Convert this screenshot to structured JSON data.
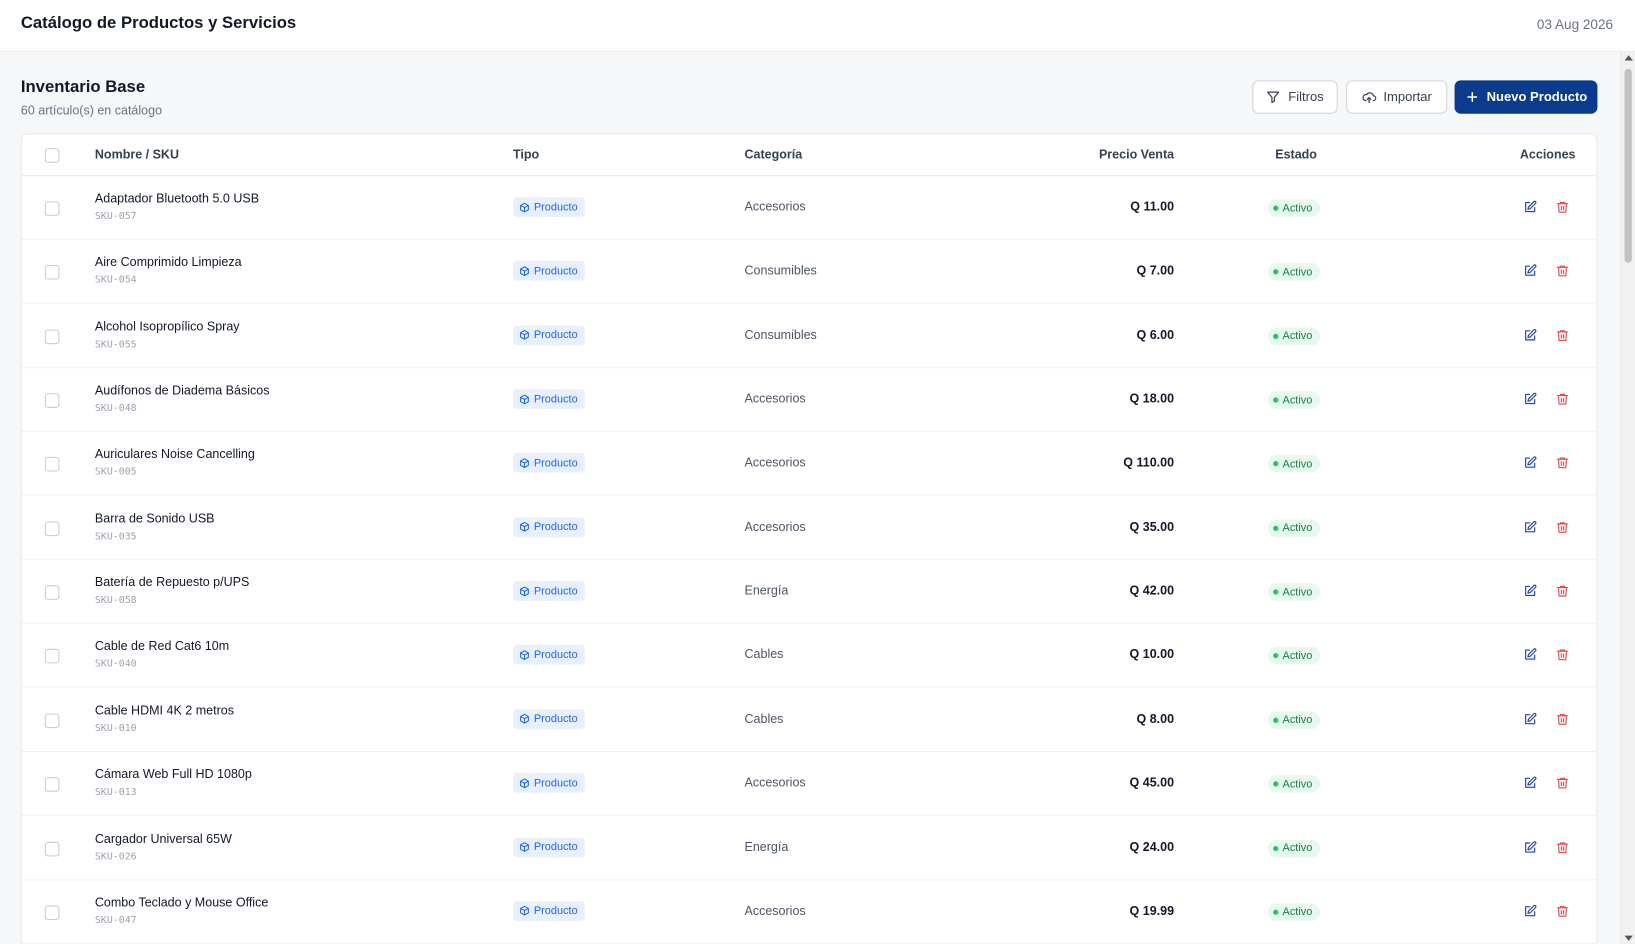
{
  "header": {
    "title": "Catálogo de Productos y Servicios",
    "date": "03 Aug 2026"
  },
  "section": {
    "title": "Inventario Base",
    "subtitle": "60 artículo(s) en catálogo"
  },
  "toolbar": {
    "filters_label": "Filtros",
    "import_label": "Importar",
    "new_label": "Nuevo Producto"
  },
  "table": {
    "columns": {
      "name": "Nombre / SKU",
      "type": "Tipo",
      "category": "Categoría",
      "price": "Precio Venta",
      "status": "Estado",
      "actions": "Acciones"
    },
    "rows": [
      {
        "name": "Adaptador Bluetooth 5.0 USB",
        "sku": "SKU-057",
        "type": "Producto",
        "category": "Accesorios",
        "price": "Q 11.00",
        "status": "Activo"
      },
      {
        "name": "Aire Comprimido Limpieza",
        "sku": "SKU-054",
        "type": "Producto",
        "category": "Consumibles",
        "price": "Q 7.00",
        "status": "Activo"
      },
      {
        "name": "Alcohol Isopropílico Spray",
        "sku": "SKU-055",
        "type": "Producto",
        "category": "Consumibles",
        "price": "Q 6.00",
        "status": "Activo"
      },
      {
        "name": "Audífonos de Diadema Básicos",
        "sku": "SKU-048",
        "type": "Producto",
        "category": "Accesorios",
        "price": "Q 18.00",
        "status": "Activo"
      },
      {
        "name": "Auriculares Noise Cancelling",
        "sku": "SKU-005",
        "type": "Producto",
        "category": "Accesorios",
        "price": "Q 110.00",
        "status": "Activo"
      },
      {
        "name": "Barra de Sonido USB",
        "sku": "SKU-035",
        "type": "Producto",
        "category": "Accesorios",
        "price": "Q 35.00",
        "status": "Activo"
      },
      {
        "name": "Batería de Repuesto p/UPS",
        "sku": "SKU-058",
        "type": "Producto",
        "category": "Energía",
        "price": "Q 42.00",
        "status": "Activo"
      },
      {
        "name": "Cable de Red Cat6 10m",
        "sku": "SKU-040",
        "type": "Producto",
        "category": "Cables",
        "price": "Q 10.00",
        "status": "Activo"
      },
      {
        "name": "Cable HDMI 4K 2 metros",
        "sku": "SKU-010",
        "type": "Producto",
        "category": "Cables",
        "price": "Q 8.00",
        "status": "Activo"
      },
      {
        "name": "Cámara Web Full HD 1080p",
        "sku": "SKU-013",
        "type": "Producto",
        "category": "Accesorios",
        "price": "Q 45.00",
        "status": "Activo"
      },
      {
        "name": "Cargador Universal 65W",
        "sku": "SKU-026",
        "type": "Producto",
        "category": "Energía",
        "price": "Q 24.00",
        "status": "Activo"
      },
      {
        "name": "Combo Teclado y Mouse Office",
        "sku": "SKU-047",
        "type": "Producto",
        "category": "Accesorios",
        "price": "Q 19.99",
        "status": "Activo"
      }
    ]
  },
  "icons": {
    "filters": "filter-icon",
    "import": "upload-cloud-icon",
    "new": "plus-icon",
    "type": "box-icon",
    "edit": "edit-icon",
    "delete": "trash-icon"
  },
  "colors": {
    "primary": "#0b3b8c",
    "type_badge_bg": "#e8f0fe",
    "type_badge_text": "#2563eb",
    "status_bg": "#e7f8ef",
    "status_text": "#15803d",
    "delete": "#ef4444",
    "edit": "#1e40af"
  }
}
